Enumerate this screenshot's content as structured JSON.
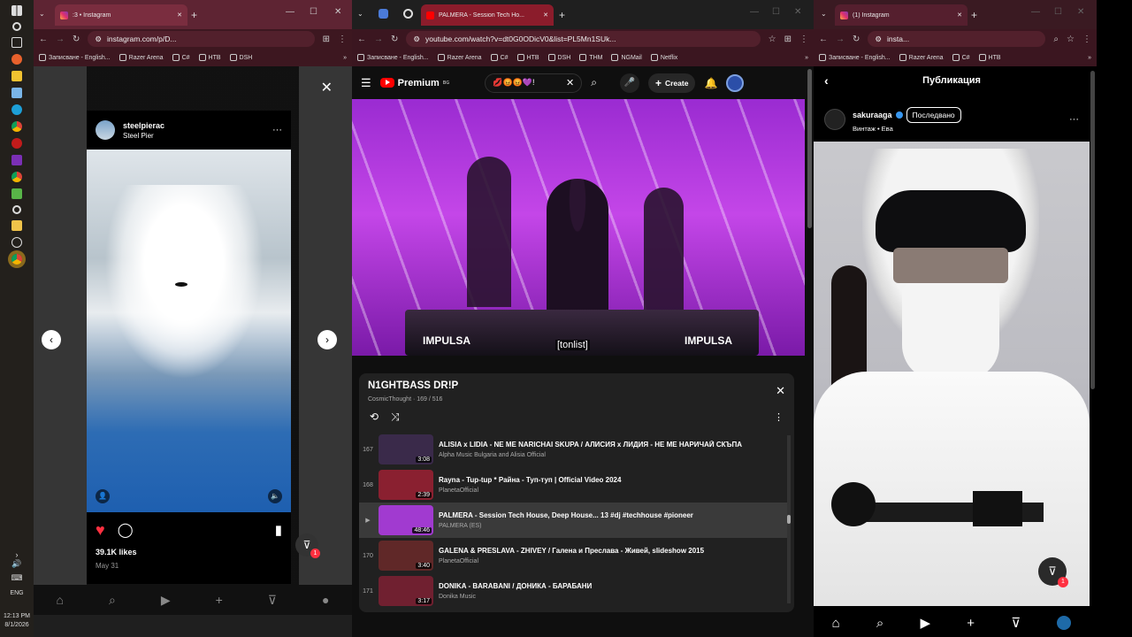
{
  "taskbar": {
    "time": "12:13 PM",
    "date": "8/1/2026",
    "lang": "ENG"
  },
  "left": {
    "tab_title": ":3 • Instagram",
    "url": "instagram.com/p/D...",
    "bookmarks": [
      "Записване - English...",
      "Razer Arena",
      "C#",
      "HTB",
      "DSH"
    ],
    "post": {
      "username": "steelpierac",
      "location": "Steel Pier",
      "likes": "39.1K likes",
      "date": "May 31"
    },
    "badge": "1"
  },
  "middle": {
    "tab_title": "PALMERA - Session Tech Ho...",
    "url": "youtube.com/watch?v=dt0G0ODicV0&list=PL5Mn1SUk...",
    "bookmarks": [
      "Записване - English...",
      "Razer Arena",
      "C#",
      "HTB",
      "DSH",
      "THM",
      "NGMail",
      "Netflix"
    ],
    "logo": "Premium",
    "logo_sup": "BG",
    "search_value": "💋😡😡💜!",
    "create_label": "Create",
    "caption": "[tonlist]",
    "overlay_brand": "IMPULSA",
    "playlist": {
      "title": "N1GHTBASS DR!P",
      "meta": "CosmicThought · 169 / 516",
      "items": [
        {
          "index": "167",
          "title": "ALISIA x LIDIA - NE ME NARICHAI SKUPA / АЛИСИЯ x ЛИДИЯ - НЕ МЕ НАРИЧАЙ СКЪПА",
          "channel": "Alpha Music Bulgaria and Alisia Official",
          "duration": "3:08",
          "active": false
        },
        {
          "index": "168",
          "title": "Rayna - Tup-tup * Райна - Туп-туп | Official Video 2024",
          "channel": "PlanetaOfficial",
          "duration": "2:39",
          "active": false
        },
        {
          "index": "▶",
          "title": "PALMERA - Session Tech House, Deep House... 13 #dj #techhouse #pioneer",
          "channel": "PALMERA (ES)",
          "duration": "48:46",
          "active": true
        },
        {
          "index": "170",
          "title": "GALENA & PRESLAVA - ZHIVEY / Галена и Преслава - Живей, slideshow 2015",
          "channel": "PlanetaOfficial",
          "duration": "3:40",
          "active": false
        },
        {
          "index": "171",
          "title": "DONIKA - BARABANI / ДОНИКА - БАРАБАНИ",
          "channel": "Donika Music",
          "duration": "3:17",
          "active": false
        }
      ]
    }
  },
  "right": {
    "tab_title": "(1) Instagram",
    "url": "insta...",
    "bookmarks": [
      "Записване - English...",
      "Razer Arena",
      "C#",
      "HTB"
    ],
    "header_title": "Публикация",
    "username": "sakuraaga",
    "follow_label": "Последвано",
    "subtitle": "Винтаж • Ева",
    "badge": "1"
  },
  "colors": {
    "yt_red": "#ff0000",
    "ig_like": "#ff3040",
    "purple": "#b52bd8"
  }
}
